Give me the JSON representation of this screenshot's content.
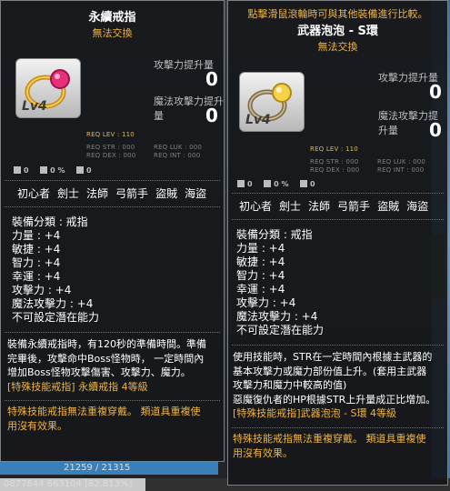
{
  "left_panel": {
    "title": "永續戒指",
    "tradability": "無法交換",
    "attack_increase_label": "攻擊力提升量",
    "attack_increase_value": "0",
    "magic_increase_label": "魔法攻擊力提升量",
    "magic_increase_value": "0",
    "level_badge": "Lv4",
    "req_lev": "REQ LEV : 110",
    "req_str": "REQ STR : 000",
    "req_luk": "REQ LUK : 000",
    "req_dex": "REQ DEX : 000",
    "req_int": "REQ INT : 000",
    "icon_stats": [
      "0",
      "0 %",
      "0"
    ],
    "jobs": [
      "初心者",
      "劍士",
      "法師",
      "弓箭手",
      "盜賊",
      "海盜"
    ],
    "stats": [
      "裝備分類 : 戒指",
      "力量 : +4",
      "敏捷 : +4",
      "智力 : +4",
      "幸運 : +4",
      "攻擊力 : +4",
      "魔法攻擊力 : +4",
      "不可設定潛在能力"
    ],
    "description": [
      "裝備永續戒指時，有120秒的準備時間。準備",
      "完畢後，攻擊命中Boss怪物時， 一定時間內",
      "增加Boss怪物攻擊傷害、攻擊力、魔力。"
    ],
    "skill_line": "[特殊技能戒指] 永續戒指 4等級",
    "footer": [
      "特殊技能戒指無法重複穿戴。 類道具重複使",
      "用沒有效果。"
    ]
  },
  "right_panel": {
    "compare_notice": "點擊滑鼠滾輪時可與其他裝備進行比較。",
    "title": "武器泡泡 - S環",
    "tradability": "無法交換",
    "attack_increase_label": "攻擊力提升量",
    "attack_increase_value": "0",
    "magic_increase_label": "魔法攻擊力提升量",
    "magic_increase_value": "0",
    "level_badge": "Lv4",
    "req_lev": "REQ LEV : 110",
    "req_str": "REQ STR : 000",
    "req_luk": "REQ LUK : 000",
    "req_dex": "REQ DEX : 000",
    "req_int": "REQ INT : 000",
    "icon_stats": [
      "0",
      "0 %",
      "0"
    ],
    "jobs": [
      "初心者",
      "劍士",
      "法師",
      "弓箭手",
      "盜賊",
      "海盜"
    ],
    "stats": [
      "裝備分類 : 戒指",
      "力量 : +4",
      "敏捷 : +4",
      "智力 : +4",
      "幸運 : +4",
      "攻擊力 : +4",
      "魔法攻擊力 : +4",
      "不可設定潛在能力"
    ],
    "description": [
      "使用技能時，STR在一定時間內根據主武器的",
      "基本攻擊力或魔力部份值上升。(套用主武器",
      "攻擊力和魔力中較高的值)",
      "惡魔復仇者的HP根據STR上升量成正比增加。"
    ],
    "skill_line": "[特殊技能戒指]武器泡泡 - S環 4等級",
    "footer": [
      "特殊技能戒指無法重複穿戴。 類道具重複使",
      "用沒有效果。"
    ]
  },
  "hud": {
    "hp_text": "21259 / 21315",
    "exp_text": "0877844 663104 [82.813%]"
  },
  "colors": {
    "panel_bg": "#16181b",
    "accent_yellow": "#f0b43a",
    "panel_border": "#7d8083"
  }
}
